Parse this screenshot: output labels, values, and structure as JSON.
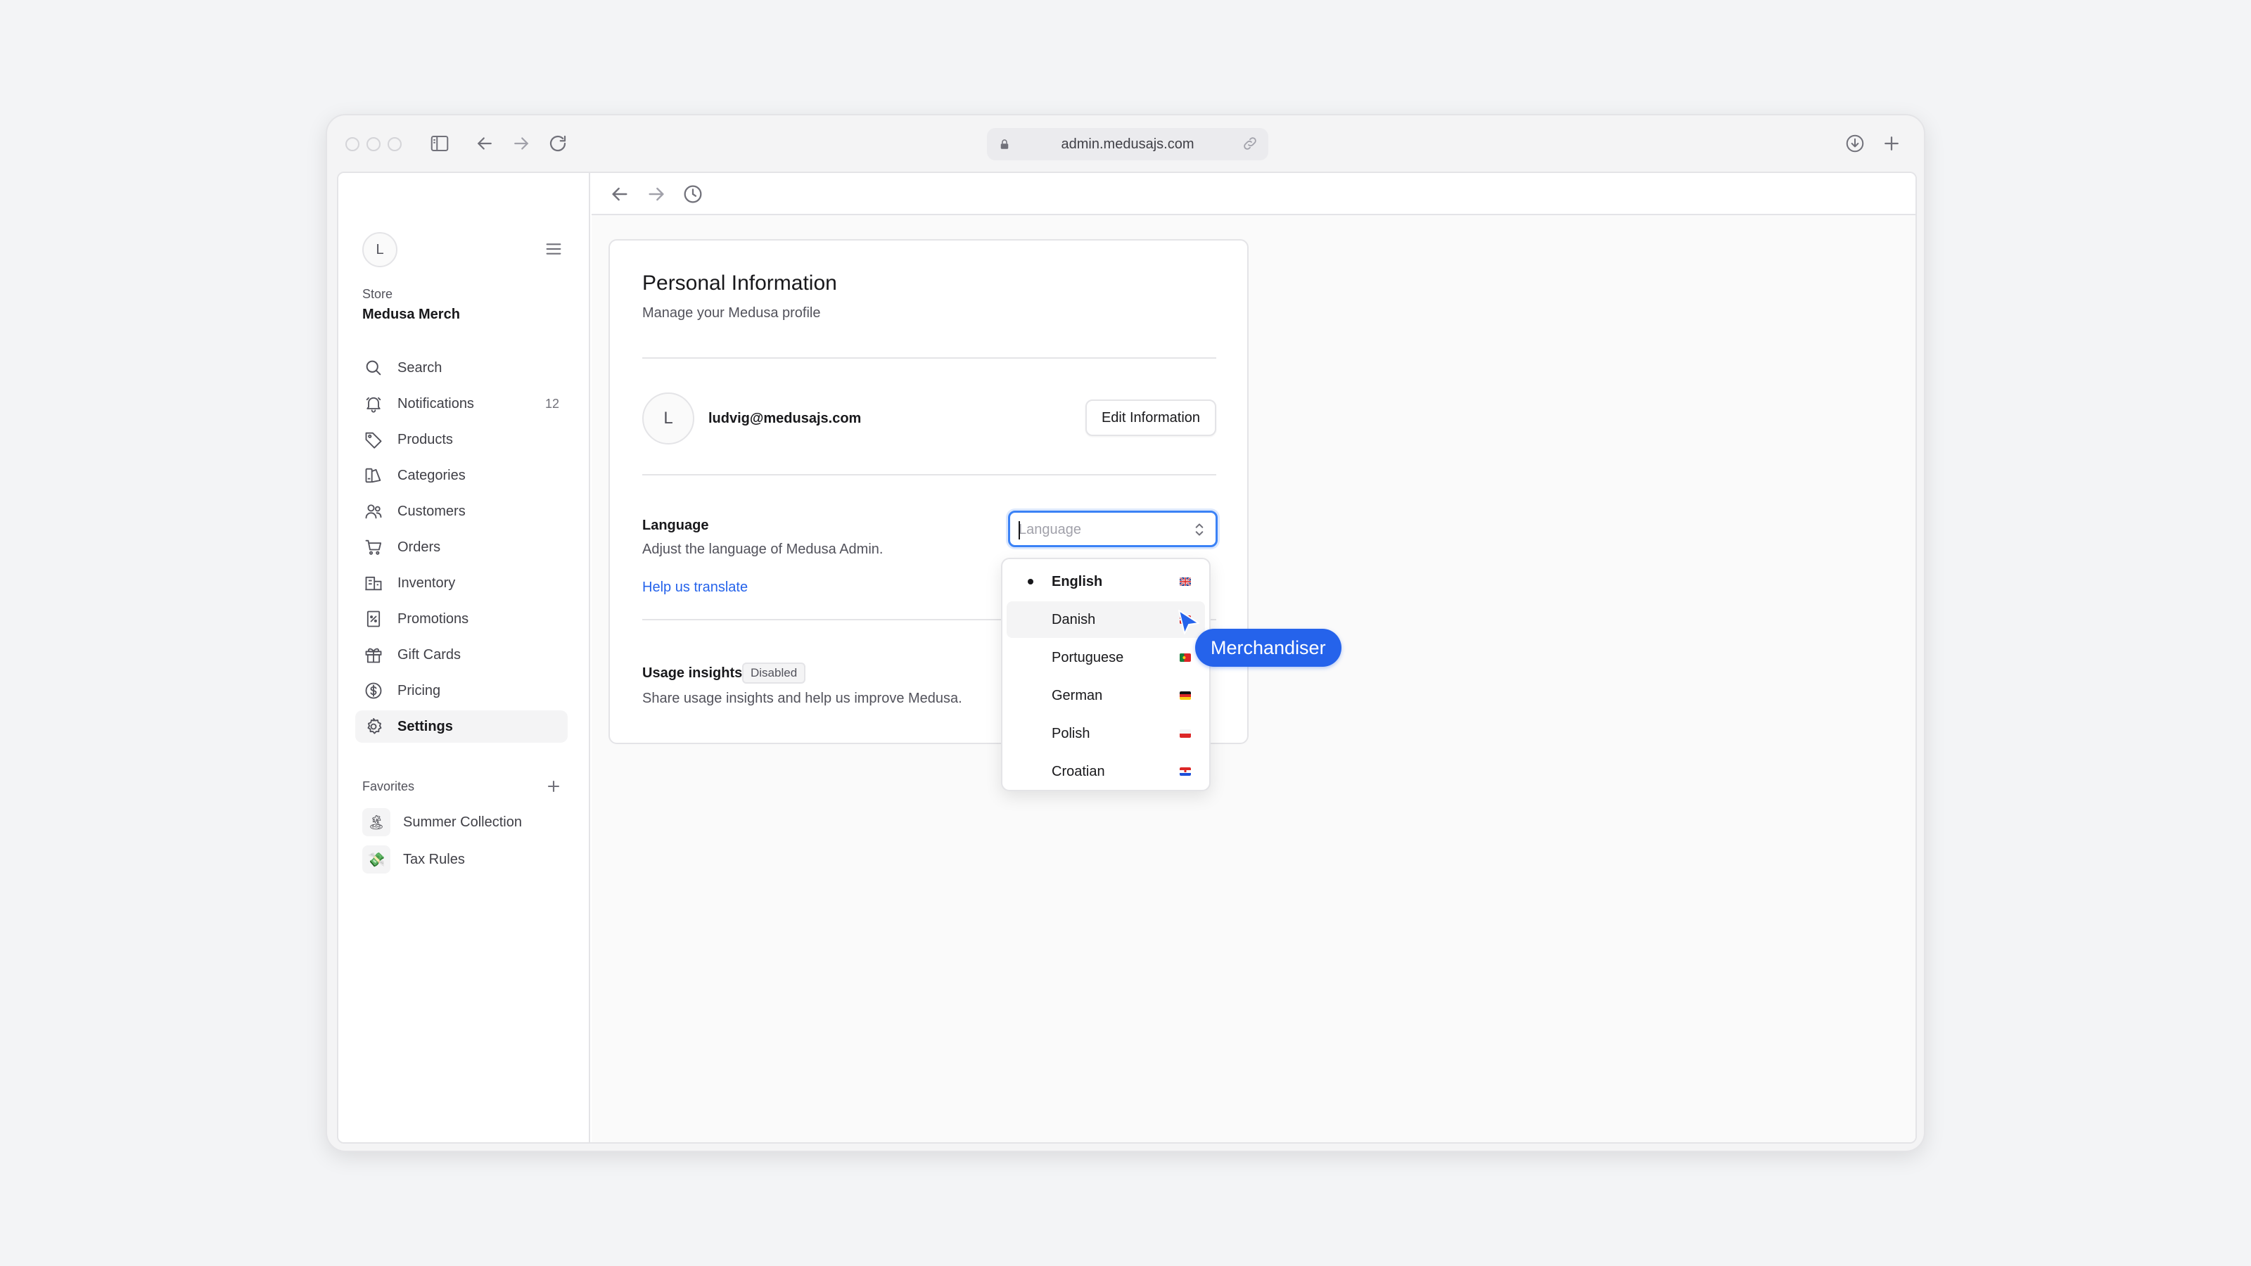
{
  "browser": {
    "url": "admin.medusajs.com"
  },
  "sidebar": {
    "avatar_initial": "L",
    "store_label": "Store",
    "store_name": "Medusa Merch",
    "items": [
      {
        "label": "Search",
        "icon": "search-icon"
      },
      {
        "label": "Notifications",
        "icon": "bell-icon",
        "count": "12"
      },
      {
        "label": "Products",
        "icon": "tag-icon"
      },
      {
        "label": "Categories",
        "icon": "categories-icon"
      },
      {
        "label": "Customers",
        "icon": "users-icon"
      },
      {
        "label": "Orders",
        "icon": "cart-icon"
      },
      {
        "label": "Inventory",
        "icon": "building-icon"
      },
      {
        "label": "Promotions",
        "icon": "receipt-percent-icon"
      },
      {
        "label": "Gift Cards",
        "icon": "gift-icon"
      },
      {
        "label": "Pricing",
        "icon": "currency-icon"
      },
      {
        "label": "Settings",
        "icon": "gear-icon",
        "active": true
      }
    ],
    "favorites_label": "Favorites",
    "favorites": [
      {
        "label": "Summer Collection",
        "emoji": "🏝"
      },
      {
        "label": "Tax Rules",
        "emoji": "💸"
      }
    ]
  },
  "profile": {
    "title": "Personal Information",
    "subtitle": "Manage your Medusa profile",
    "avatar_initial": "L",
    "email": "ludvig@medusajs.com",
    "edit_button": "Edit Information",
    "language_label": "Language",
    "language_description": "Adjust the language of Medusa Admin.",
    "help_translate": "Help us translate",
    "language_placeholder": "Language",
    "usage_label": "Usage insights",
    "usage_badge": "Disabled",
    "usage_description": "Share usage insights and help us improve Medusa."
  },
  "language_options": [
    {
      "label": "English",
      "selected": true
    },
    {
      "label": "Danish",
      "hover": true
    },
    {
      "label": "Portuguese"
    },
    {
      "label": "German"
    },
    {
      "label": "Polish"
    },
    {
      "label": "Croatian"
    }
  ],
  "cursor": {
    "label": "Merchandiser",
    "color": "#2563eb"
  },
  "colors": {
    "accent": "#2563eb",
    "focus_ring": "#3b82f6"
  }
}
